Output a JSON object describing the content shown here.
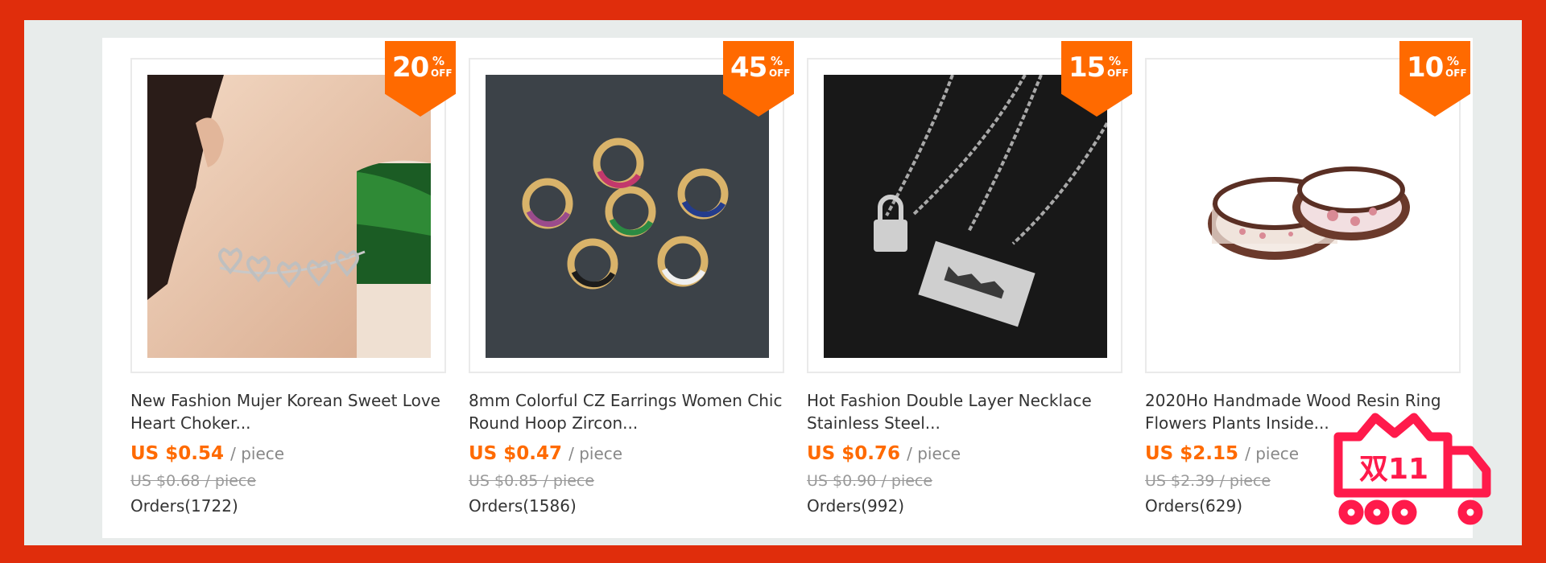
{
  "products": [
    {
      "discount": "20",
      "percent_symbol": "%",
      "off_label": "OFF",
      "title_line1": "New Fashion Mujer Korean Sweet Love",
      "title_line2": "Heart Choker...",
      "price": "US $0.54",
      "unit": "/ piece",
      "original_price": "US $0.68 / piece",
      "orders": "Orders(1722)",
      "image_icon": "heart-choker-image"
    },
    {
      "discount": "45",
      "percent_symbol": "%",
      "off_label": "OFF",
      "title_line1": "8mm Colorful CZ Earrings Women Chic",
      "title_line2": "Round Hoop Zircon...",
      "price": "US $0.47",
      "unit": "/ piece",
      "original_price": "US $0.85 / piece",
      "orders": "Orders(1586)",
      "image_icon": "hoop-earrings-image"
    },
    {
      "discount": "15",
      "percent_symbol": "%",
      "off_label": "OFF",
      "title_line1": "Hot Fashion Double Layer Necklace",
      "title_line2": "Stainless Steel...",
      "price": "US $0.76",
      "unit": "/ piece",
      "original_price": "US $0.90 / piece",
      "orders": "Orders(992)",
      "image_icon": "lock-blade-necklace-image"
    },
    {
      "discount": "10",
      "percent_symbol": "%",
      "off_label": "OFF",
      "title_line1": "2020Ho Handmade Wood Resin Ring",
      "title_line2": "Flowers Plants Inside...",
      "price": "US $2.15",
      "unit": "/ piece",
      "original_price": "US $2.39 / piece",
      "orders": "Orders(629)",
      "image_icon": "resin-rings-image"
    }
  ],
  "promo_logo": {
    "text": "双11",
    "icon": "double-11-cart-logo",
    "color": "#ff1a4b"
  },
  "colors": {
    "frame": "#e02d0c",
    "accent": "#ff6a00",
    "background": "#e8eceb"
  }
}
